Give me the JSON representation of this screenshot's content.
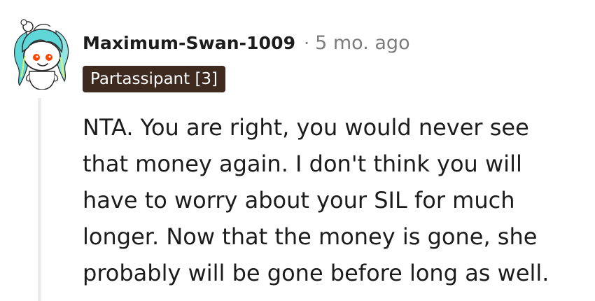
{
  "comment": {
    "author": "Maximum-Swan-1009",
    "separator": "·",
    "timestamp": "5 mo. ago",
    "flair": "Partassipant [3]",
    "body_lines": [
      "NTA. You are right, you would never see",
      "that money again. I don't think you will",
      "have to worry about your SIL for much",
      "longer. Now that the money is gone, she",
      "probably will be gone before long as well."
    ]
  },
  "avatar": {
    "icon": "snoo-avatar-icon",
    "hair_color": "#5fd6d8",
    "eye_color": "#ff4500"
  },
  "colors": {
    "flair_background": "#3e2a1f",
    "meta_text": "#7c7c7c",
    "thread_line": "#ededed"
  }
}
